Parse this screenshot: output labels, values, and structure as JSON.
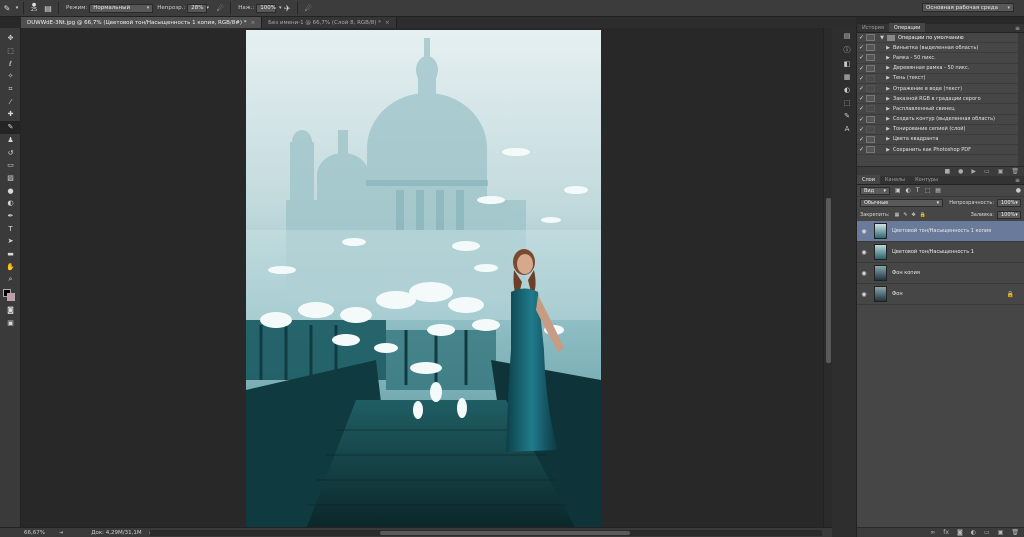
{
  "options_bar": {
    "brush_size": "25",
    "mode_label": "Режим:",
    "mode_value": "Нормальный",
    "opacity_label": "Непрозр.:",
    "opacity_value": "28%",
    "flow_label": "Наж.:",
    "flow_value": "100%",
    "workspace": "Основная рабочая среда"
  },
  "doc_tabs": [
    {
      "label": "DUWWdE-3Nt.jpg @ 66,7% (Цветовой тон/Насыщенность 1 копия, RGB/8#) *"
    },
    {
      "label": "Без имени-1 @ 66,7% (Слой 8, RGB/8) *"
    }
  ],
  "status": {
    "zoom": "66,67%",
    "doc_size": "Док: 4,29M/31,1M"
  },
  "history_panel": {
    "tabs": [
      "История",
      "Операции"
    ],
    "active_tab": "Операции",
    "set_name": "Операции по умолчанию",
    "actions": [
      "Виньетка (выделенная область)",
      "Рамка - 50 пикс.",
      "Деревянная рамка - 50 пикс.",
      "Тень (текст)",
      "Отражение в воде (текст)",
      "Заказной RGB в градации серого",
      "Расплавленный свинец",
      "Создать контур (выделенная область)",
      "Тонирование сепией (слой)",
      "Цвета квадранта",
      "Сохранить как Photoshop PDF"
    ]
  },
  "layers_panel": {
    "tabs": [
      "Слои",
      "Каналы",
      "Контуры"
    ],
    "filter_kind": "Вид",
    "blend_mode": "Обычные",
    "opacity_label": "Непрозрачность:",
    "opacity_value": "100%",
    "lock_label": "Закрепить:",
    "fill_label": "Заливка:",
    "fill_value": "100%",
    "layers": [
      {
        "name": "Цветовой тон/Насыщенность 1 копия",
        "selected": true
      },
      {
        "name": "Цветовой тон/Насыщенность 1",
        "selected": false
      },
      {
        "name": "Фон копия",
        "selected": false
      },
      {
        "name": "Фон",
        "selected": false,
        "locked": true
      }
    ]
  },
  "colors": {
    "foreground": "#000000",
    "background": "#c89aa4",
    "selected_layer": "#6a7a9a"
  }
}
